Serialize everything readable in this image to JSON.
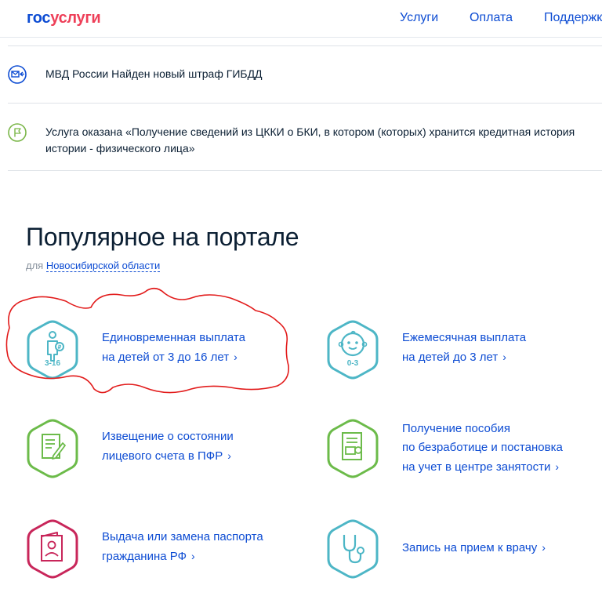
{
  "header": {
    "logo_part1": "гос",
    "logo_part2": "услуги",
    "nav": [
      {
        "label": "Услуги"
      },
      {
        "label": "Оплата"
      },
      {
        "label": "Поддержк"
      }
    ]
  },
  "notifications": [
    {
      "icon": "mail-arrow-icon",
      "text_line1": "МВД России Найден новый штраф ГИБДД",
      "text_line2": ""
    },
    {
      "icon": "flag-icon",
      "text_line1": "Услуга оказана «Получение сведений из ЦККИ о БКИ, в котором (которых) хранится кредитная история",
      "text_line2": "истории - физического лица»"
    }
  ],
  "popular": {
    "title": "Популярное на портале",
    "region_prefix": "для",
    "region_link": "Новосибирской области",
    "services": [
      {
        "icon": "child-3-16-icon",
        "icon_badge": "3-16",
        "line1": "Единовременная выплата",
        "line2": "на детей от 3 до 16 лет",
        "line3": "",
        "color": "#4db6c6"
      },
      {
        "icon": "baby-0-3-icon",
        "icon_badge": "0-3",
        "line1": "Ежемесячная выплата",
        "line2": "на детей до 3 лет",
        "line3": "",
        "color": "#4db6c6"
      },
      {
        "icon": "document-edit-icon",
        "icon_badge": "",
        "line1": "Извещение о состоянии",
        "line2": "лицевого счета в ПФР",
        "line3": "",
        "color": "#6cbb4a"
      },
      {
        "icon": "employment-document-icon",
        "icon_badge": "",
        "line1": "Получение пособия",
        "line2": "по безработице и постановка",
        "line3": "на учет в центре занятости",
        "color": "#6cbb4a"
      },
      {
        "icon": "passport-icon",
        "icon_badge": "",
        "line1": "Выдача или замена паспорта",
        "line2": "гражданина РФ",
        "line3": "",
        "color": "#c8265a"
      },
      {
        "icon": "stethoscope-icon",
        "icon_badge": "",
        "line1": "Запись на прием к врачу",
        "line2": "",
        "line3": "",
        "color": "#4db6c6"
      }
    ]
  },
  "colors": {
    "link": "#0d4cd3",
    "logo_blue": "#0d4cd3",
    "logo_red": "#ee3f58",
    "annotation_red": "#e21b1b"
  },
  "chevron": "›"
}
